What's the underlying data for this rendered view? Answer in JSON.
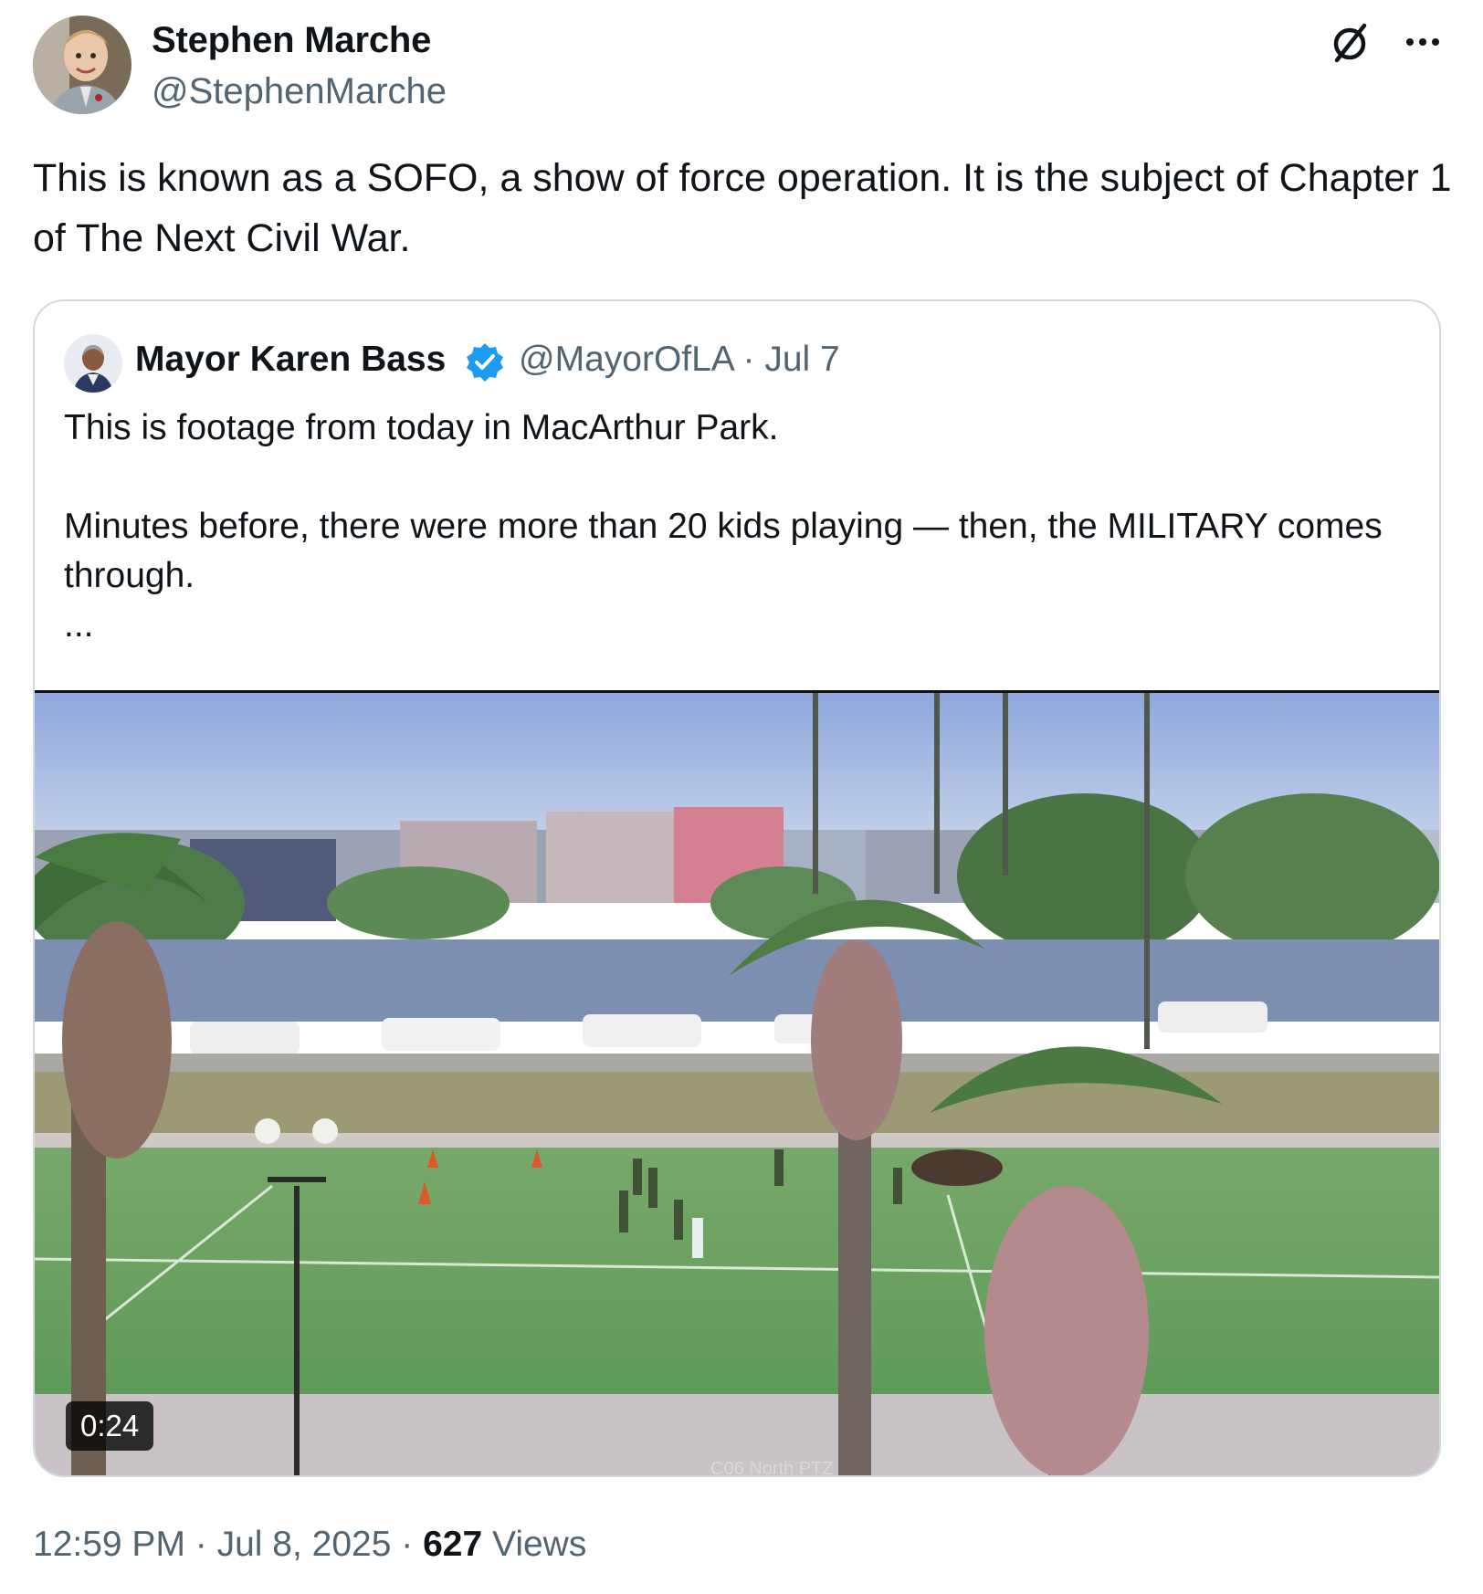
{
  "author": {
    "name": "Stephen Marche",
    "handle": "@StephenMarche"
  },
  "tweet": {
    "text": "This is known as a SOFO, a show of force operation. It is the subject of Chapter 1 of The Next Civil War."
  },
  "quoted": {
    "name": "Mayor Karen Bass",
    "handle": "@MayorOfLA",
    "separator": "·",
    "date": "Jul 7",
    "paragraphs": [
      "This is footage from today in MacArthur Park.",
      "Minutes before, there were more than 20 kids playing — then, the MILITARY comes through.",
      "..."
    ],
    "video": {
      "duration": "0:24",
      "watermark": "C06 North PTZ"
    }
  },
  "footer": {
    "time": "12:59 PM",
    "sep1": " · ",
    "date": "Jul 8, 2025",
    "sep2": " · ",
    "views_count": "627",
    "views_label": " Views"
  },
  "icons": {
    "grok": "grok-icon",
    "more": "more-icon",
    "verified": "verified-badge-icon"
  },
  "colors": {
    "text": "#0f1419",
    "secondary": "#536471",
    "verified": "#1d9bf0",
    "border": "#cfd9de"
  }
}
